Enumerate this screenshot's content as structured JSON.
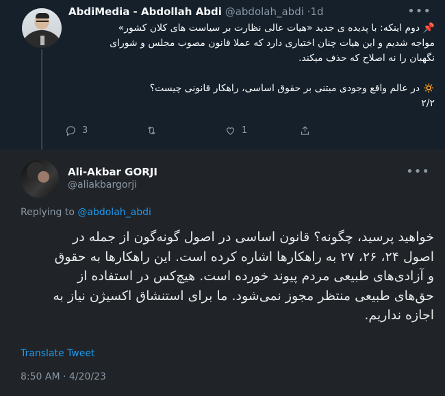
{
  "parent_tweet": {
    "author_name": "AbdiMedia - Abdollah Abdi",
    "author_handle": "@abdolah_abdi",
    "separator": "·",
    "time": "1d",
    "lines": [
      "📌 دوم اینکه: با پدیده ی جدید «هیات عالی نظارت بر سیاست های کلان کشور»",
      "مواجه شدیم و این هیات چنان اختیاری دارد که عملا قانون مصوب مجلس و شورای",
      "نگهبان را نه اصلاح که حذف میکند."
    ],
    "lines2": [
      "🔅 در عالم واقع وجودی مبتنی بر حقوق اساسی، راهکار قانونی چیست؟",
      "۲/۲"
    ],
    "stats": {
      "replies": "3",
      "retweets": "",
      "likes": "1"
    }
  },
  "main_tweet": {
    "author_name": "Ali-Akbar GORJI",
    "author_handle": "@aliakbargorji",
    "replying_prefix": "Replying to",
    "replying_to": "@abdolah_abdi",
    "lines": [
      "خواهید پرسید، چگونه؟ قانون اساسی در اصول گونه‌گون از جمله در",
      "اصول ۲۴، ۲۶، ۲۷ به راهکارها اشاره کرده است. این راهکارها به حقوق",
      "و آزادی‌های طبیعی مردم پیوند خورده است. هیچ‌کس در استفاده از",
      "حق‌های طبیعی منتظر مجوز نمی‌شود. ما برای استنشاق اکسیژن نیاز به",
      "اجازه نداریم."
    ],
    "translate_label": "Translate Tweet",
    "timestamp": "8:50 AM · 4/20/23"
  },
  "icons": [
    "reply-icon",
    "retweet-icon",
    "like-icon",
    "share-icon",
    "more-icon"
  ],
  "colors": {
    "background": "#15202b",
    "accent": "#1d9bf0",
    "muted": "#8b98a5"
  }
}
